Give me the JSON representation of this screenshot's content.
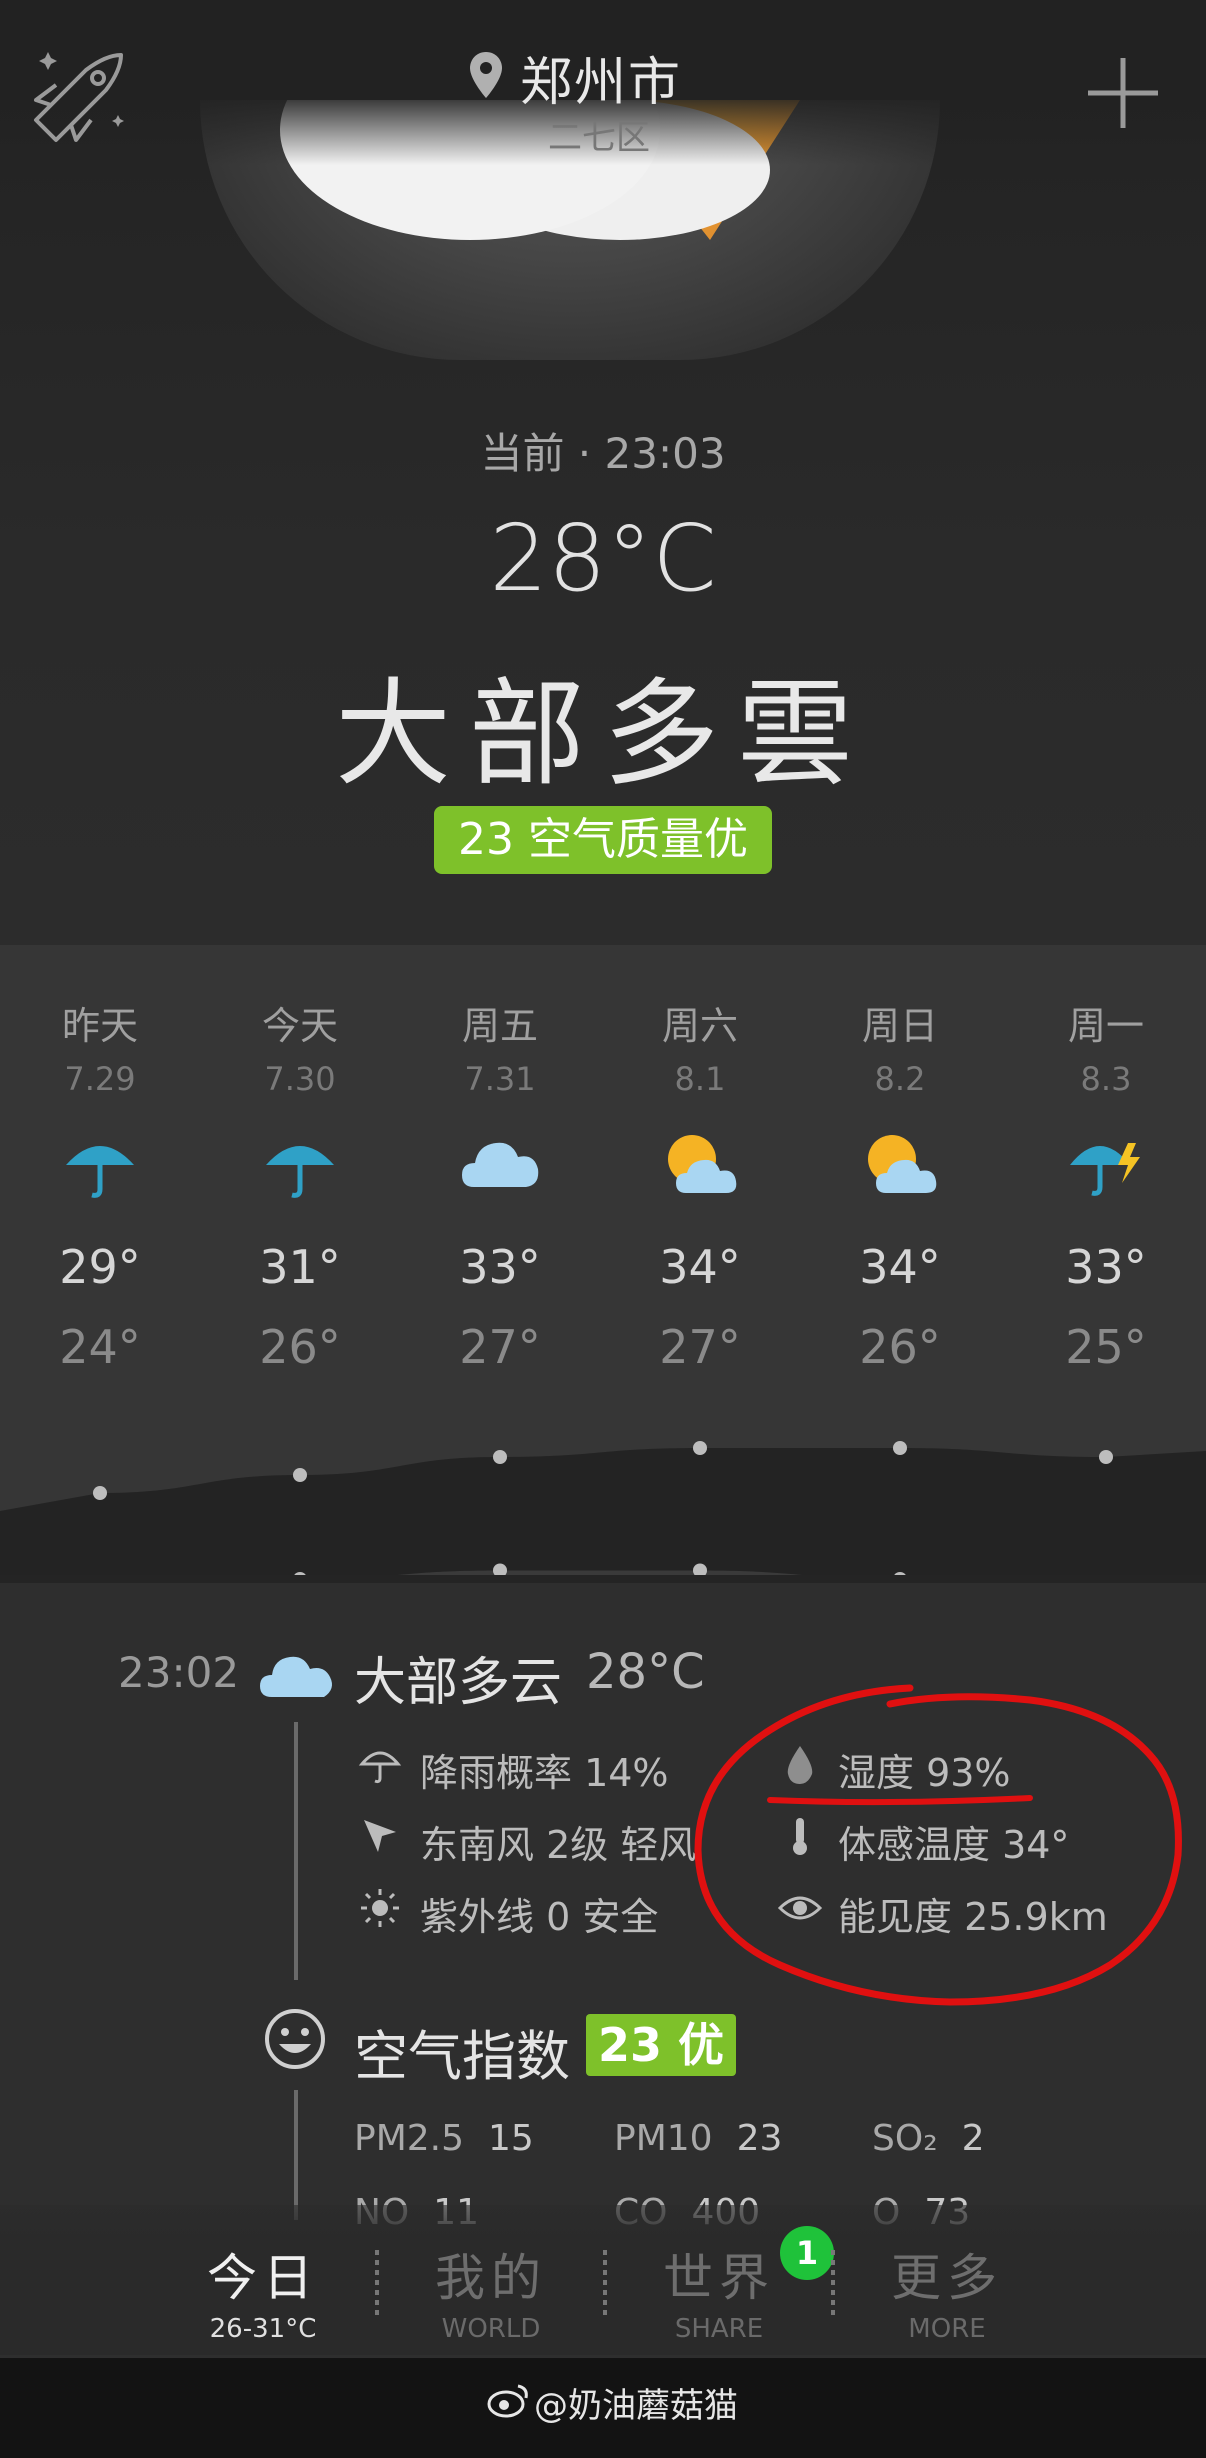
{
  "header": {
    "city": "郑州市",
    "district": "二七区"
  },
  "current": {
    "time_label": "当前 · 23:03",
    "temperature": "28°C",
    "condition": "大部多雲",
    "aqi_badge": "23 空气质量优"
  },
  "forecast": [
    {
      "day": "昨天",
      "date": "7.29",
      "icon": "umbrella-icon",
      "high": "29°",
      "low": "24°"
    },
    {
      "day": "今天",
      "date": "7.30",
      "icon": "umbrella-icon",
      "high": "31°",
      "low": "26°"
    },
    {
      "day": "周五",
      "date": "7.31",
      "icon": "cloud-icon",
      "high": "33°",
      "low": "27°"
    },
    {
      "day": "周六",
      "date": "8.1",
      "icon": "sun-cloud-icon",
      "high": "34°",
      "low": "27°"
    },
    {
      "day": "周日",
      "date": "8.2",
      "icon": "sun-cloud-icon",
      "high": "34°",
      "low": "26°"
    },
    {
      "day": "周一",
      "date": "8.3",
      "icon": "thunder-umbrella-icon",
      "high": "33°",
      "low": "25°"
    }
  ],
  "temp_curve": {
    "highs": [
      29,
      31,
      33,
      34,
      34,
      33
    ],
    "lows": [
      24,
      26,
      27,
      27,
      26,
      25
    ]
  },
  "details": {
    "time": "23:02",
    "condition": "大部多云",
    "temperature": "28°C",
    "rain_chance": "降雨概率 14%",
    "wind": "东南风 2级 轻风",
    "uv": "紫外线 0 安全",
    "humidity": "湿度 93%",
    "feels_like": "体感温度 34°",
    "visibility": "能见度 25.9km"
  },
  "air": {
    "title": "空气指数",
    "badge": "23 优",
    "pollutants": [
      {
        "name": "PM2.5",
        "value": "15"
      },
      {
        "name": "PM10",
        "value": "23"
      },
      {
        "name": "SO₂",
        "value": "2"
      },
      {
        "name": "NO",
        "value": "11"
      },
      {
        "name": "CO",
        "value": "400"
      },
      {
        "name": "O",
        "value": "73"
      }
    ]
  },
  "tabs": [
    {
      "label": "今日",
      "sub": "26-31°C"
    },
    {
      "label": "我的",
      "sub": "WORLD"
    },
    {
      "label": "世界",
      "sub": "SHARE"
    },
    {
      "label": "更多",
      "sub": "MORE"
    }
  ],
  "notification_count": "1",
  "watermark": "@奶油蘑菇猫",
  "colors": {
    "aqi_green": "#7ec12a",
    "annotation_red": "#e01010",
    "notif_green": "#1fc23a"
  }
}
